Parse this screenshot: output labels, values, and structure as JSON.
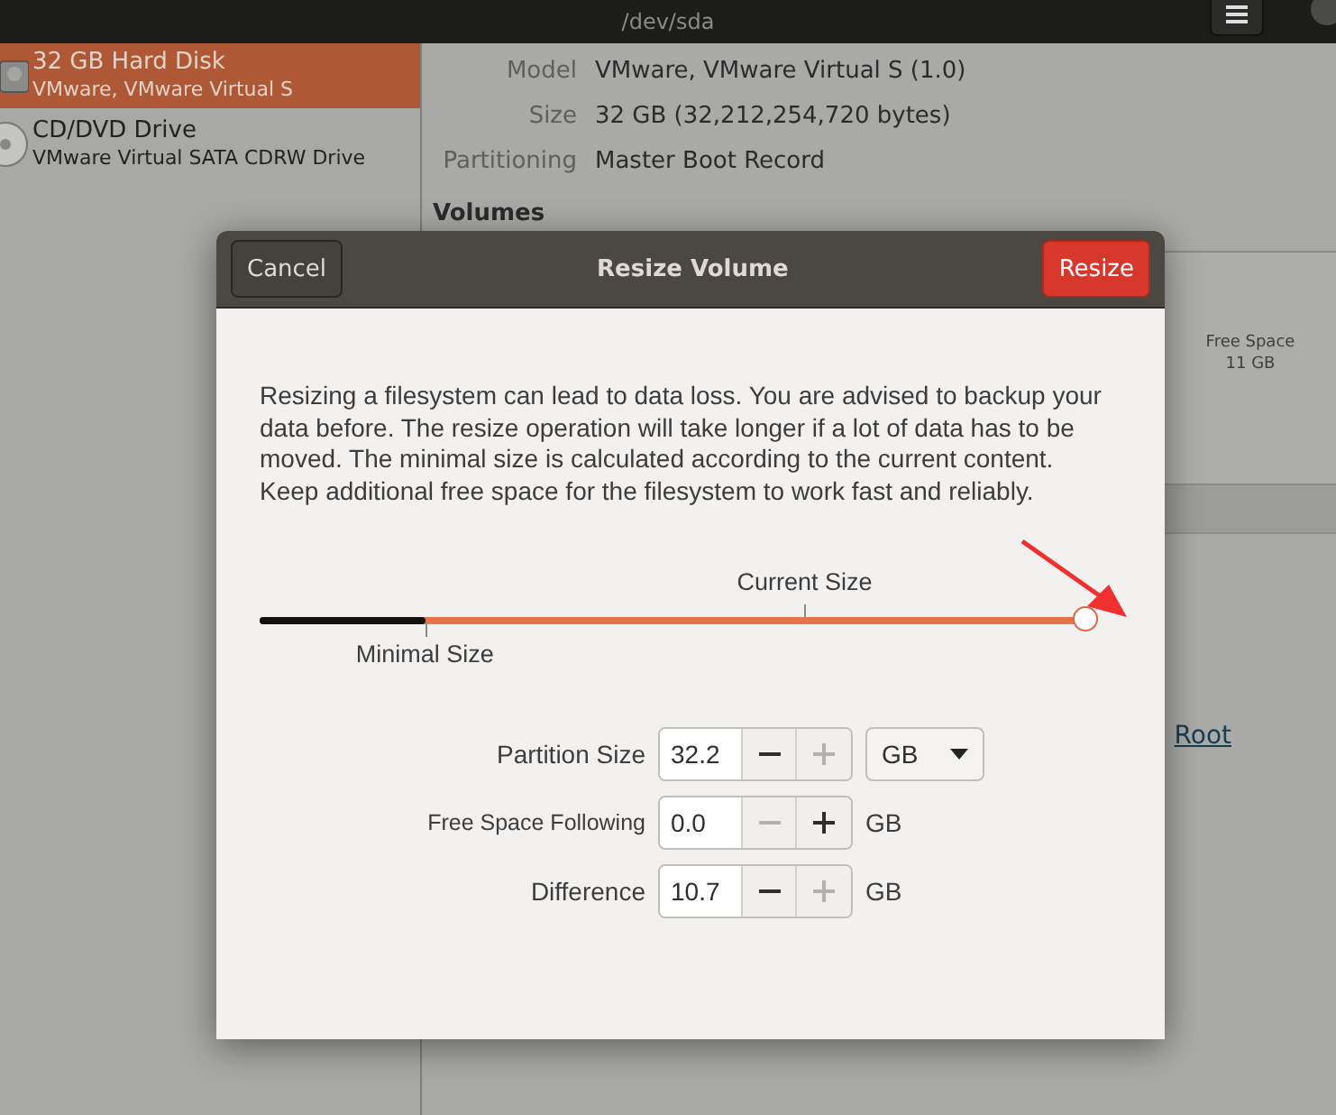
{
  "header": {
    "subtitle": "/dev/sda"
  },
  "sidebar": {
    "items": [
      {
        "kind": "disk",
        "title": "32 GB Hard Disk",
        "subtitle": "VMware, VMware Virtual S",
        "selected": true
      },
      {
        "kind": "optical",
        "title": "CD/DVD Drive",
        "subtitle": "VMware Virtual SATA CDRW Drive",
        "selected": false
      }
    ]
  },
  "details": [
    {
      "label": "Model",
      "value": "VMware, VMware Virtual S (1.0)"
    },
    {
      "label": "Size",
      "value": "32 GB (32,212,254,720 bytes)"
    },
    {
      "label": "Partitioning",
      "value": "Master Boot Record"
    }
  ],
  "volumes": {
    "heading": "Volumes",
    "free_space": {
      "label": "Free Space",
      "size": "11 GB"
    },
    "link": "Root"
  },
  "dialog": {
    "title": "Resize Volume",
    "cancel": "Cancel",
    "confirm": "Resize",
    "message": "Resizing a filesystem can lead to data loss. You are advised to backup your data before. The resize operation will take longer if a lot of data has to be moved. The minimal size is calculated according to the current content. Keep additional free space for the filesystem to work fast and reliably.",
    "slider": {
      "level": 1.0,
      "marks": [
        {
          "kind": "minimal",
          "label": "Minimal Size",
          "level": 0.2
        },
        {
          "kind": "current",
          "label": "Current Size",
          "level": 0.66
        }
      ]
    },
    "fields": [
      {
        "label": "Partition Size",
        "value": "32.2",
        "minus_disabled": false,
        "plus_disabled": true,
        "kind": "dropdown",
        "unit": "GB"
      },
      {
        "label": "Free Space Following",
        "value": "0.0",
        "minus_disabled": true,
        "plus_disabled": false,
        "kind": "text",
        "unit": "GB"
      },
      {
        "label": "Difference",
        "value": "10.7",
        "minus_disabled": false,
        "plus_disabled": true,
        "kind": "text",
        "unit": "GB"
      }
    ]
  }
}
